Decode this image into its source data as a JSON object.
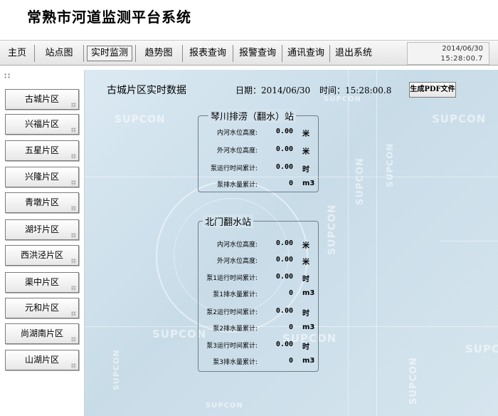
{
  "app": {
    "title": "常熟市河道监测平台系统"
  },
  "menu": {
    "items": [
      {
        "label": "主页"
      },
      {
        "label": "站点图"
      },
      {
        "label": "实时监测"
      },
      {
        "label": "趋势图"
      },
      {
        "label": "报表查询"
      },
      {
        "label": "报警查询"
      },
      {
        "label": "通讯查询"
      },
      {
        "label": "退出系统"
      }
    ],
    "active": "实时监测",
    "clock_date": "2014/06/30",
    "clock_time": "15:28:00.7"
  },
  "sidebar": {
    "items": [
      {
        "label": "古城片区"
      },
      {
        "label": "兴福片区"
      },
      {
        "label": "五星片区"
      },
      {
        "label": "兴隆片区"
      },
      {
        "label": "青墩片区"
      },
      {
        "label": "湖圩片区"
      },
      {
        "label": "西洪泾片区"
      },
      {
        "label": "渠中片区"
      },
      {
        "label": "元和片区"
      },
      {
        "label": "尚湖南片区"
      },
      {
        "label": "山湖片区"
      }
    ]
  },
  "main": {
    "heading": "古城片区实时数据",
    "date_label": "日期：2014/06/30",
    "time_label": "时间：15:28:00.8",
    "pdf_button": "生成PDF文件",
    "watermark": "SUPCON"
  },
  "stations": [
    {
      "name": "琴川排涝（翻水）站",
      "rows": [
        {
          "label": "内河水位高度:",
          "value": "0.00",
          "unit": "米"
        },
        {
          "label": "外河水位高度:",
          "value": "0.00",
          "unit": "米"
        },
        {
          "label": "泵运行时间累计:",
          "value": "0.00",
          "unit": "时"
        },
        {
          "label": "泵排水量累计:",
          "value": "0",
          "unit": "m3"
        }
      ]
    },
    {
      "name": "北门翻水站",
      "rows": [
        {
          "label": "内河水位高度:",
          "value": "0.00",
          "unit": "米"
        },
        {
          "label": "外河水位高度:",
          "value": "0.00",
          "unit": "米"
        },
        {
          "label": "泵1运行时间累计:",
          "value": "0.00",
          "unit": "时"
        },
        {
          "label": "泵1排水量累计:",
          "value": "0",
          "unit": "m3"
        },
        {
          "label": "泵2运行时间累计:",
          "value": "0.00",
          "unit": "时"
        },
        {
          "label": "泵2排水量累计:",
          "value": "0",
          "unit": "m3"
        },
        {
          "label": "泵3运行时间累计:",
          "value": "0.00",
          "unit": "时"
        },
        {
          "label": "泵3排水量累计:",
          "value": "0",
          "unit": "m3"
        }
      ]
    }
  ]
}
